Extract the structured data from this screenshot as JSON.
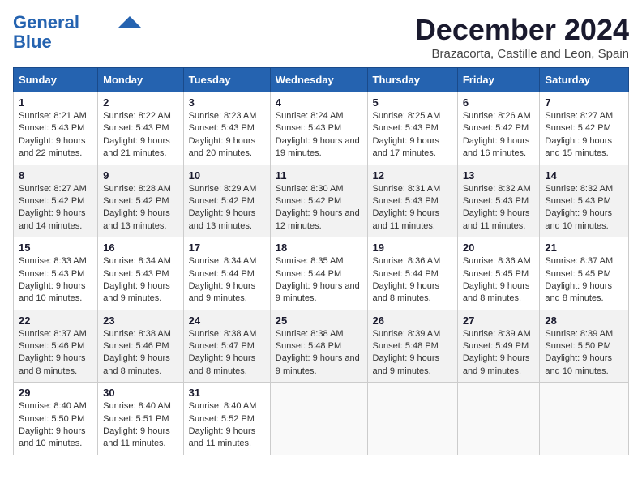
{
  "header": {
    "logo_line1": "General",
    "logo_line2": "Blue",
    "main_title": "December 2024",
    "subtitle": "Brazacorta, Castille and Leon, Spain"
  },
  "days_of_week": [
    "Sunday",
    "Monday",
    "Tuesday",
    "Wednesday",
    "Thursday",
    "Friday",
    "Saturday"
  ],
  "weeks": [
    [
      {
        "day": "1",
        "sunrise": "8:21 AM",
        "sunset": "5:43 PM",
        "daylight": "9 hours and 22 minutes."
      },
      {
        "day": "2",
        "sunrise": "8:22 AM",
        "sunset": "5:43 PM",
        "daylight": "9 hours and 21 minutes."
      },
      {
        "day": "3",
        "sunrise": "8:23 AM",
        "sunset": "5:43 PM",
        "daylight": "9 hours and 20 minutes."
      },
      {
        "day": "4",
        "sunrise": "8:24 AM",
        "sunset": "5:43 PM",
        "daylight": "9 hours and 19 minutes."
      },
      {
        "day": "5",
        "sunrise": "8:25 AM",
        "sunset": "5:43 PM",
        "daylight": "9 hours and 17 minutes."
      },
      {
        "day": "6",
        "sunrise": "8:26 AM",
        "sunset": "5:42 PM",
        "daylight": "9 hours and 16 minutes."
      },
      {
        "day": "7",
        "sunrise": "8:27 AM",
        "sunset": "5:42 PM",
        "daylight": "9 hours and 15 minutes."
      }
    ],
    [
      {
        "day": "8",
        "sunrise": "8:27 AM",
        "sunset": "5:42 PM",
        "daylight": "9 hours and 14 minutes."
      },
      {
        "day": "9",
        "sunrise": "8:28 AM",
        "sunset": "5:42 PM",
        "daylight": "9 hours and 13 minutes."
      },
      {
        "day": "10",
        "sunrise": "8:29 AM",
        "sunset": "5:42 PM",
        "daylight": "9 hours and 13 minutes."
      },
      {
        "day": "11",
        "sunrise": "8:30 AM",
        "sunset": "5:42 PM",
        "daylight": "9 hours and 12 minutes."
      },
      {
        "day": "12",
        "sunrise": "8:31 AM",
        "sunset": "5:43 PM",
        "daylight": "9 hours and 11 minutes."
      },
      {
        "day": "13",
        "sunrise": "8:32 AM",
        "sunset": "5:43 PM",
        "daylight": "9 hours and 11 minutes."
      },
      {
        "day": "14",
        "sunrise": "8:32 AM",
        "sunset": "5:43 PM",
        "daylight": "9 hours and 10 minutes."
      }
    ],
    [
      {
        "day": "15",
        "sunrise": "8:33 AM",
        "sunset": "5:43 PM",
        "daylight": "9 hours and 10 minutes."
      },
      {
        "day": "16",
        "sunrise": "8:34 AM",
        "sunset": "5:43 PM",
        "daylight": "9 hours and 9 minutes."
      },
      {
        "day": "17",
        "sunrise": "8:34 AM",
        "sunset": "5:44 PM",
        "daylight": "9 hours and 9 minutes."
      },
      {
        "day": "18",
        "sunrise": "8:35 AM",
        "sunset": "5:44 PM",
        "daylight": "9 hours and 9 minutes."
      },
      {
        "day": "19",
        "sunrise": "8:36 AM",
        "sunset": "5:44 PM",
        "daylight": "9 hours and 8 minutes."
      },
      {
        "day": "20",
        "sunrise": "8:36 AM",
        "sunset": "5:45 PM",
        "daylight": "9 hours and 8 minutes."
      },
      {
        "day": "21",
        "sunrise": "8:37 AM",
        "sunset": "5:45 PM",
        "daylight": "9 hours and 8 minutes."
      }
    ],
    [
      {
        "day": "22",
        "sunrise": "8:37 AM",
        "sunset": "5:46 PM",
        "daylight": "9 hours and 8 minutes."
      },
      {
        "day": "23",
        "sunrise": "8:38 AM",
        "sunset": "5:46 PM",
        "daylight": "9 hours and 8 minutes."
      },
      {
        "day": "24",
        "sunrise": "8:38 AM",
        "sunset": "5:47 PM",
        "daylight": "9 hours and 8 minutes."
      },
      {
        "day": "25",
        "sunrise": "8:38 AM",
        "sunset": "5:48 PM",
        "daylight": "9 hours and 9 minutes."
      },
      {
        "day": "26",
        "sunrise": "8:39 AM",
        "sunset": "5:48 PM",
        "daylight": "9 hours and 9 minutes."
      },
      {
        "day": "27",
        "sunrise": "8:39 AM",
        "sunset": "5:49 PM",
        "daylight": "9 hours and 9 minutes."
      },
      {
        "day": "28",
        "sunrise": "8:39 AM",
        "sunset": "5:50 PM",
        "daylight": "9 hours and 10 minutes."
      }
    ],
    [
      {
        "day": "29",
        "sunrise": "8:40 AM",
        "sunset": "5:50 PM",
        "daylight": "9 hours and 10 minutes."
      },
      {
        "day": "30",
        "sunrise": "8:40 AM",
        "sunset": "5:51 PM",
        "daylight": "9 hours and 11 minutes."
      },
      {
        "day": "31",
        "sunrise": "8:40 AM",
        "sunset": "5:52 PM",
        "daylight": "9 hours and 11 minutes."
      },
      null,
      null,
      null,
      null
    ]
  ],
  "labels": {
    "sunrise": "Sunrise:",
    "sunset": "Sunset:",
    "daylight": "Daylight:"
  }
}
